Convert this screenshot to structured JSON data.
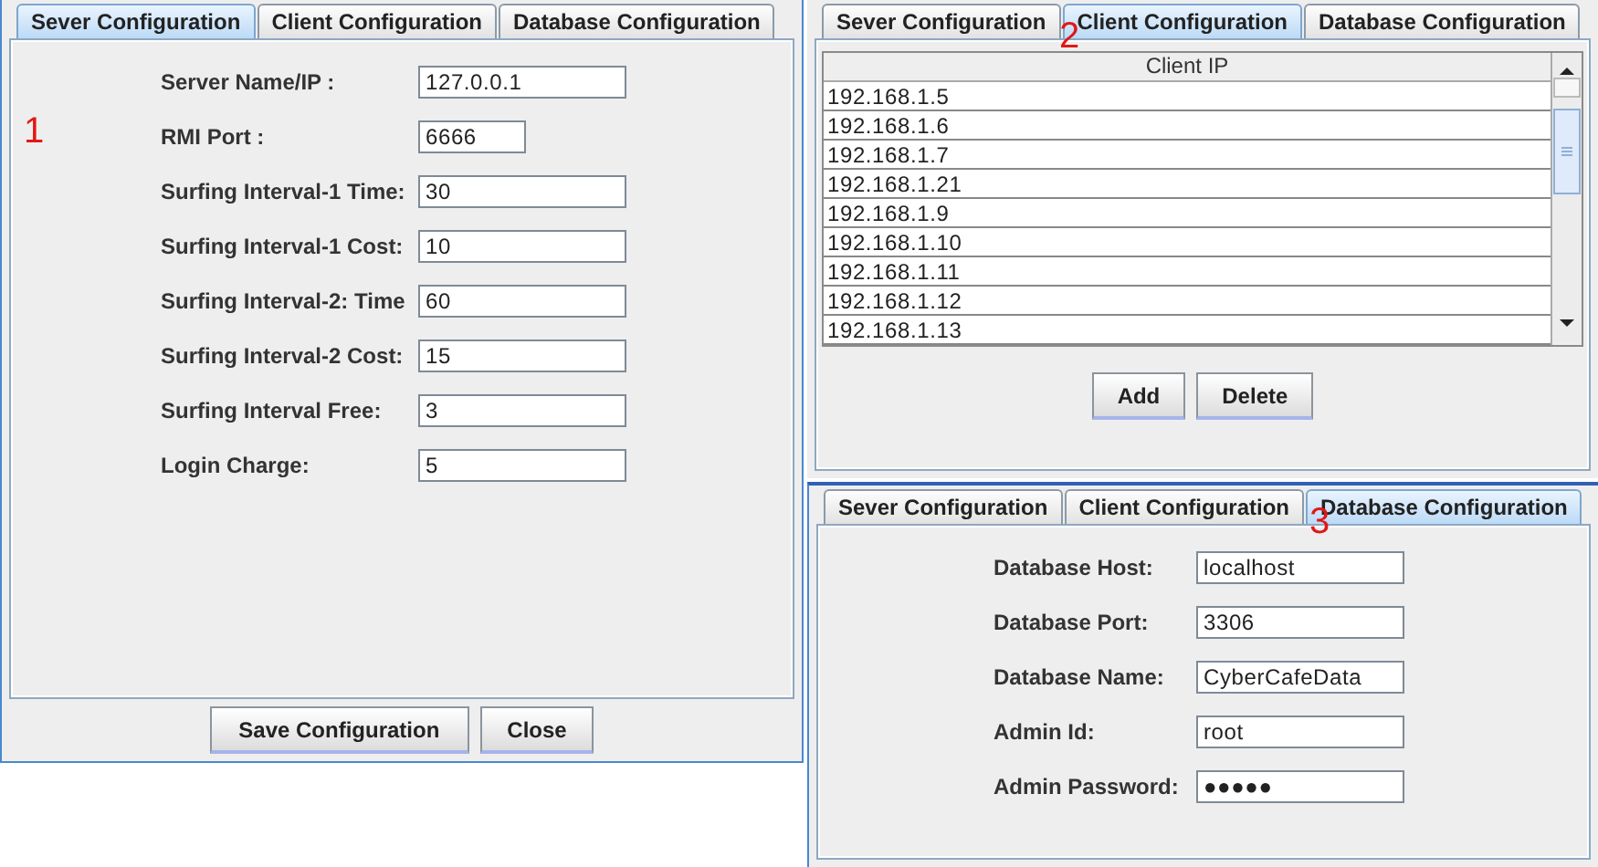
{
  "panels": [
    {
      "kind": "form",
      "annotation": "1",
      "tabs": [
        {
          "label": "Sever Configuration",
          "selected": true
        },
        {
          "label": "Client Configuration",
          "selected": false
        },
        {
          "label": "Database Configuration",
          "selected": false
        }
      ],
      "fields": [
        {
          "label": "Server Name/IP :",
          "value": "127.0.0.1",
          "kind": "wide"
        },
        {
          "label": "RMI Port :",
          "value": "6666",
          "kind": "short"
        },
        {
          "label": "Surfing Interval-1 Time:",
          "value": "30",
          "kind": "wide"
        },
        {
          "label": "Surfing Interval-1 Cost:",
          "value": "10",
          "kind": "wide"
        },
        {
          "label": "Surfing Interval-2: Time",
          "value": "60",
          "kind": "wide"
        },
        {
          "label": "Surfing Interval-2 Cost:",
          "value": "15",
          "kind": "wide"
        },
        {
          "label": "Surfing Interval Free:",
          "value": "3",
          "kind": "wide"
        },
        {
          "label": "Login Charge:",
          "value": "5",
          "kind": "wide"
        }
      ],
      "buttons": [
        "Save Configuration",
        "Close"
      ]
    },
    {
      "kind": "table",
      "annotation": "2",
      "tabs": [
        {
          "label": "Sever Configuration",
          "selected": false
        },
        {
          "label": "Client Configuration",
          "selected": true
        },
        {
          "label": "Database Configuration",
          "selected": false
        }
      ],
      "table": {
        "columns": [
          "Client IP"
        ],
        "rows": [
          "192.168.1.5",
          "192.168.1.6",
          "192.168.1.7",
          "192.168.1.21",
          "192.168.1.9",
          "192.168.1.10",
          "192.168.1.11",
          "192.168.1.12",
          "192.168.1.13"
        ]
      },
      "buttons": [
        "Add",
        "Delete"
      ]
    },
    {
      "kind": "form",
      "annotation": "3",
      "tabs": [
        {
          "label": "Sever Configuration",
          "selected": false
        },
        {
          "label": "Client Configuration",
          "selected": false
        },
        {
          "label": "Database Configuration",
          "selected": true
        }
      ],
      "fields": [
        {
          "label": "Database Host:",
          "value": "localhost",
          "kind": "wide"
        },
        {
          "label": "Database Port:",
          "value": "3306",
          "kind": "wide"
        },
        {
          "label": "Database Name:",
          "value": "CyberCafeData",
          "kind": "wide"
        },
        {
          "label": "Admin Id:",
          "value": "root",
          "kind": "wide"
        },
        {
          "label": "Admin Password:",
          "value": "●●●●●",
          "kind": "wide"
        }
      ]
    }
  ]
}
